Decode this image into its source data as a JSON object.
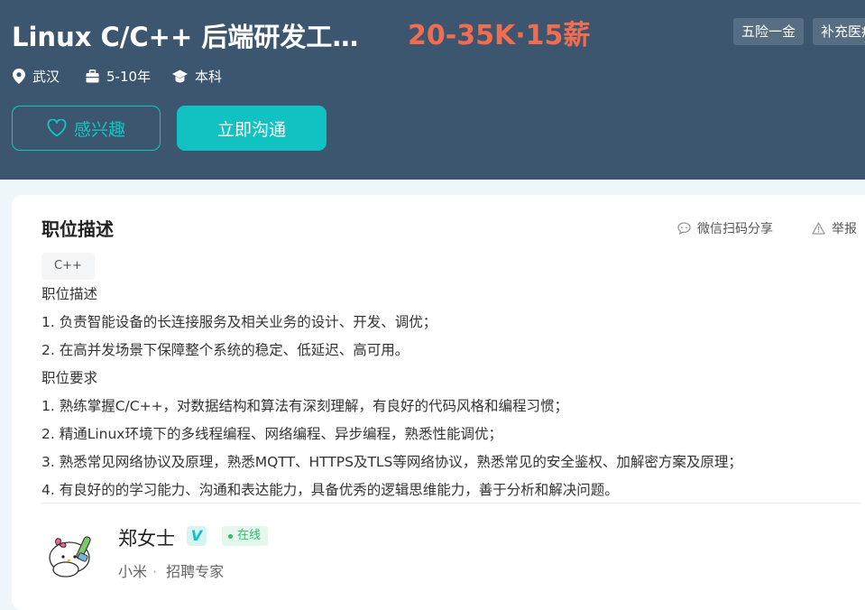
{
  "header": {
    "title": "Linux C/C++ 后端研发工…",
    "salary": "20-35K·15薪",
    "welfare": [
      "五险一金",
      "补充医疗"
    ],
    "location": "武汉",
    "experience": "5-10年",
    "education": "本科",
    "interest_label": "感兴趣",
    "chat_label": "立即沟通"
  },
  "description": {
    "title": "职位描述",
    "share_label": "微信扫码分享",
    "report_label": "举报",
    "tag": "C++",
    "lines": [
      "职位描述",
      "1. 负责智能设备的长连接服务及相关业务的设计、开发、调优；",
      "2. 在高并发场景下保障整个系统的稳定、低延迟、高可用。",
      "职位要求",
      "1. 熟练掌握C/C++，对数据结构和算法有深刻理解，有良好的代码风格和编程习惯；",
      "2. 精通Linux环境下的多线程编程、网络编程、异步编程，熟悉性能调优；",
      "3. 熟悉常见网络协议及原理，熟悉MQTT、HTTPS及TLS等网络协议，熟悉常见的安全鉴权、加解密方案及原理；",
      "4. 有良好的的学习能力、沟通和表达能力，具备优秀的逻辑思维能力，善于分析和解决问题。"
    ]
  },
  "recruiter": {
    "name": "郑女士",
    "verified_mark": "V",
    "status": "在线",
    "company": "小米",
    "separator": "·",
    "role": "招聘专家"
  },
  "colors": {
    "header_bg": "#3c566f",
    "accent": "#12c2c2",
    "salary": "#f26d4f",
    "online": "#2ebd6a"
  }
}
